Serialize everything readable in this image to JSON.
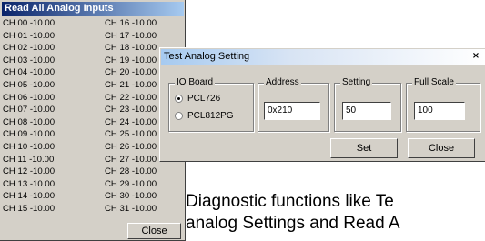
{
  "read_window": {
    "title": "Read All Analog Inputs",
    "channels_left": [
      "CH 00 -10.00",
      "CH 01 -10.00",
      "CH 02 -10.00",
      "CH 03 -10.00",
      "CH 04 -10.00",
      "CH 05 -10.00",
      "CH 06 -10.00",
      "CH 07 -10.00",
      "CH 08 -10.00",
      "CH 09 -10.00",
      "CH 10 -10.00",
      "CH 11 -10.00",
      "CH 12 -10.00",
      "CH 13 -10.00",
      "CH 14 -10.00",
      "CH 15 -10.00"
    ],
    "channels_right": [
      "CH 16 -10.00",
      "CH 17 -10.00",
      "CH 18 -10.00",
      "CH 19 -10.00",
      "CH 20 -10.00",
      "CH 21 -10.00",
      "CH 22 -10.00",
      "CH 23 -10.00",
      "CH 24 -10.00",
      "CH 25 -10.00",
      "CH 26 -10.00",
      "CH 27 -10.00",
      "CH 28 -10.00",
      "CH 29 -10.00",
      "CH 30 -10.00",
      "CH 31 -10.00"
    ],
    "close_label": "Close"
  },
  "test_dialog": {
    "title": "Test Analog Setting",
    "close_x": "×",
    "io_board": {
      "label": "IO Board",
      "options": [
        "PCL726",
        "PCL812PG"
      ],
      "selected": "PCL726"
    },
    "address": {
      "label": "Address",
      "value": "0x210"
    },
    "setting": {
      "label": "Setting",
      "value": "50"
    },
    "full_scale": {
      "label": "Full Scale",
      "value": "100"
    },
    "set_label": "Set",
    "close_label": "Close"
  },
  "caption": {
    "line1": "Diagnostic functions like Te",
    "line2": "analog Settings and Read A"
  }
}
